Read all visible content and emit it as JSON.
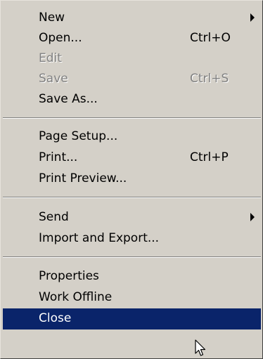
{
  "menu": {
    "items": [
      {
        "label": "New",
        "shortcut": "",
        "submenu": true,
        "disabled": false
      },
      {
        "label": "Open...",
        "shortcut": "Ctrl+O",
        "submenu": false,
        "disabled": false
      },
      {
        "label": "Edit",
        "shortcut": "",
        "submenu": false,
        "disabled": true
      },
      {
        "label": "Save",
        "shortcut": "Ctrl+S",
        "submenu": false,
        "disabled": true
      },
      {
        "label": "Save As...",
        "shortcut": "",
        "submenu": false,
        "disabled": false
      },
      {
        "label": "Page Setup...",
        "shortcut": "",
        "submenu": false,
        "disabled": false
      },
      {
        "label": "Print...",
        "shortcut": "Ctrl+P",
        "submenu": false,
        "disabled": false
      },
      {
        "label": "Print Preview...",
        "shortcut": "",
        "submenu": false,
        "disabled": false
      },
      {
        "label": "Send",
        "shortcut": "",
        "submenu": true,
        "disabled": false
      },
      {
        "label": "Import and Export...",
        "shortcut": "",
        "submenu": false,
        "disabled": false
      },
      {
        "label": "Properties",
        "shortcut": "",
        "submenu": false,
        "disabled": false
      },
      {
        "label": "Work Offline",
        "shortcut": "",
        "submenu": false,
        "disabled": false
      },
      {
        "label": "Close",
        "shortcut": "",
        "submenu": false,
        "disabled": false,
        "highlighted": true
      }
    ]
  },
  "colors": {
    "menu_background": "#d4d0c8",
    "highlight": "#0a246a",
    "disabled_text": "#808080"
  },
  "icons": {
    "submenu_arrow": "submenu-arrow-icon",
    "cursor": "mouse-pointer-icon"
  }
}
